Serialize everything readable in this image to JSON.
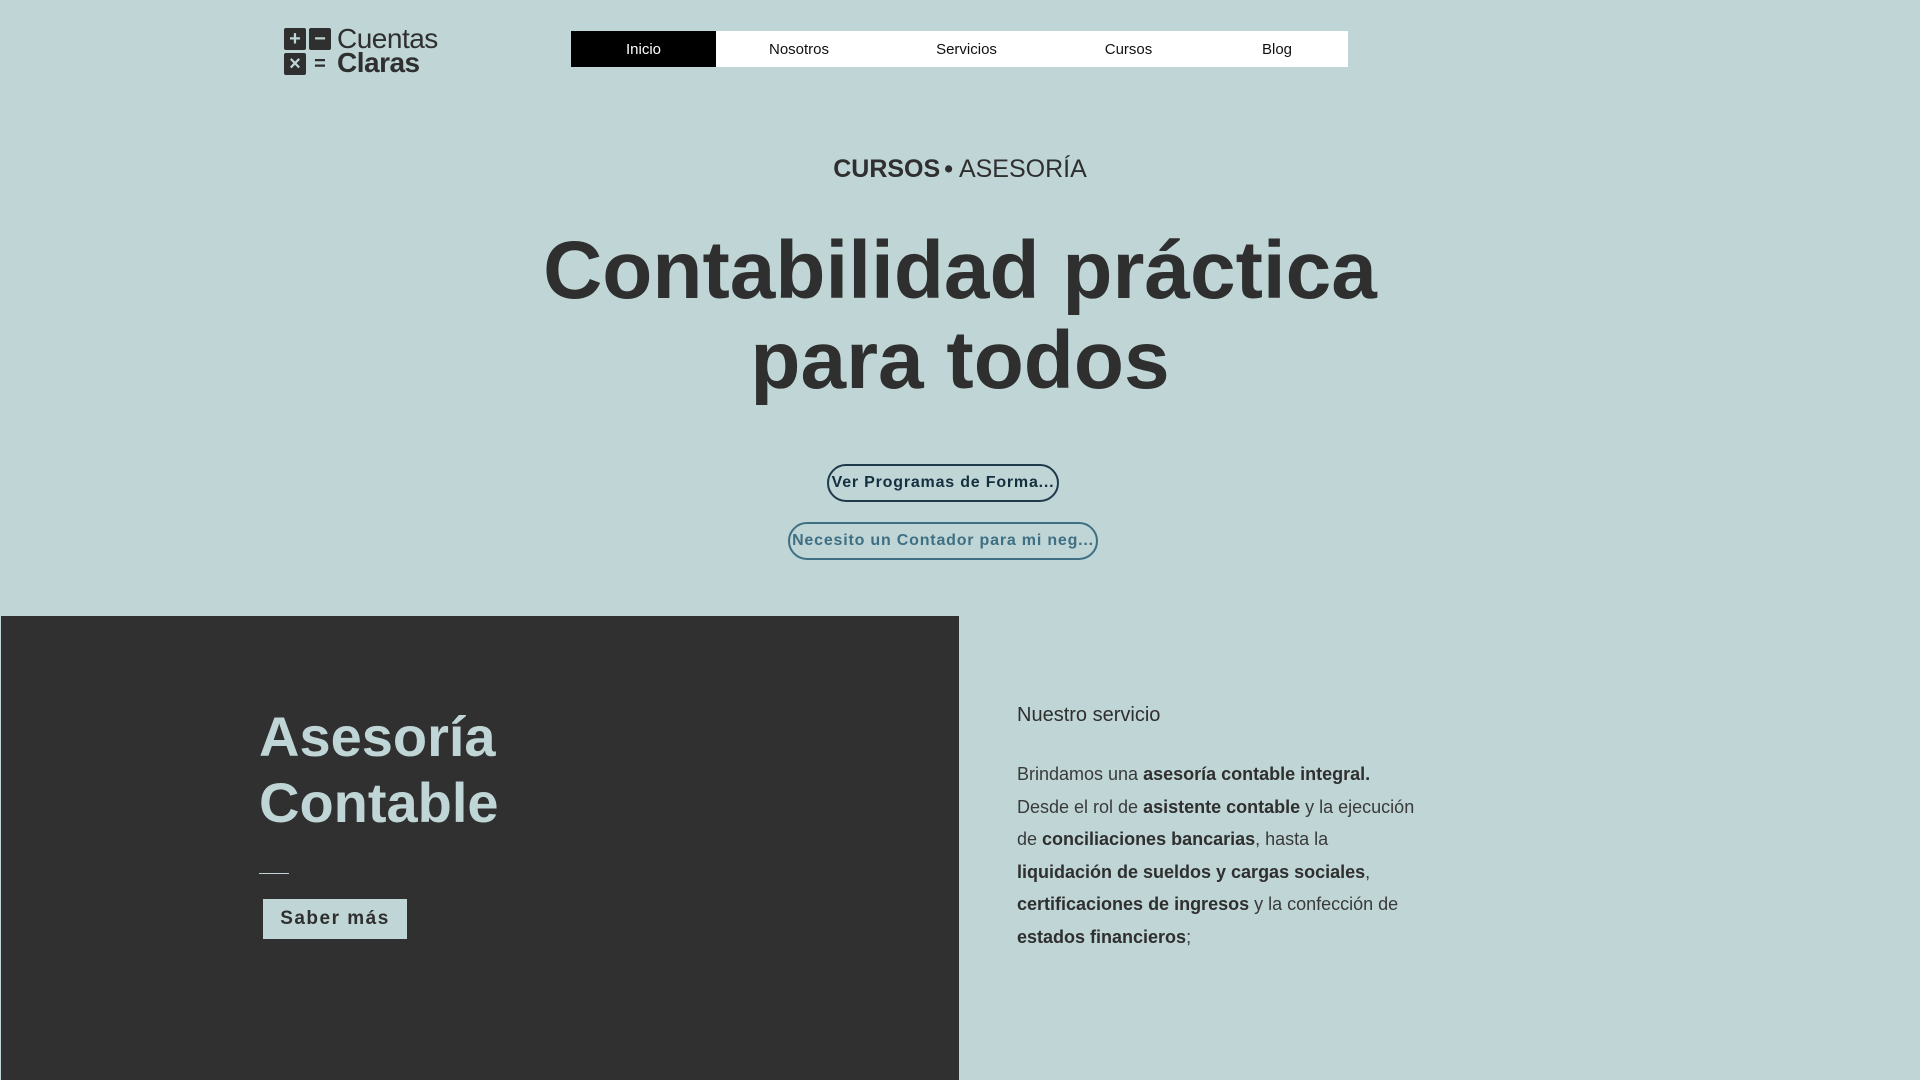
{
  "logo": {
    "glyphs": [
      "+",
      "−",
      "×",
      "="
    ],
    "line1": "Cuentas",
    "line2": "Claras"
  },
  "nav": {
    "items": [
      {
        "label": "Inicio",
        "active": true
      },
      {
        "label": "Nosotros",
        "active": false
      },
      {
        "label": "Servicios",
        "active": false
      },
      {
        "label": "Cursos",
        "active": false
      },
      {
        "label": "Blog",
        "active": false
      }
    ]
  },
  "hero": {
    "kicker_bold": "CURSOS",
    "kicker_dot": "•",
    "kicker_rest": "ASESORÍA",
    "title_line1": "Contabilidad práctica",
    "title_line2": "para todos",
    "button_primary": "Ver Programas de Forma...",
    "button_secondary": "Necesito un Contador para mi neg..."
  },
  "service_panel": {
    "title_line1": "Asesoría",
    "title_line2": "Contable",
    "button": "Saber más"
  },
  "service_text": {
    "heading": "Nuestro servicio",
    "body": [
      {
        "t": "Brindamos una ",
        "b": false
      },
      {
        "t": "asesoría contable integral.",
        "b": true
      },
      {
        "t": " Desde el rol de ",
        "b": false
      },
      {
        "t": "asistente contable",
        "b": true
      },
      {
        "t": " y la ejecución de ",
        "b": false
      },
      {
        "t": "conciliaciones bancarias",
        "b": true
      },
      {
        "t": ", hasta la ",
        "b": false
      },
      {
        "t": "liquidación de sueldos y cargas sociales",
        "b": true
      },
      {
        "t": ", ",
        "b": false
      },
      {
        "t": "certificaciones de ingresos",
        "b": true
      },
      {
        "t": " y la confección de ",
        "b": false
      },
      {
        "t": "estados financieros",
        "b": true
      },
      {
        "t": ";",
        "b": false
      }
    ]
  },
  "colors": {
    "background": "#bfd5d6",
    "dark_panel": "#303030",
    "text": "#2f2f2f",
    "nav_active_bg": "#000000",
    "button_primary_border": "#1f3a4a",
    "button_secondary": "#3f6f82"
  }
}
